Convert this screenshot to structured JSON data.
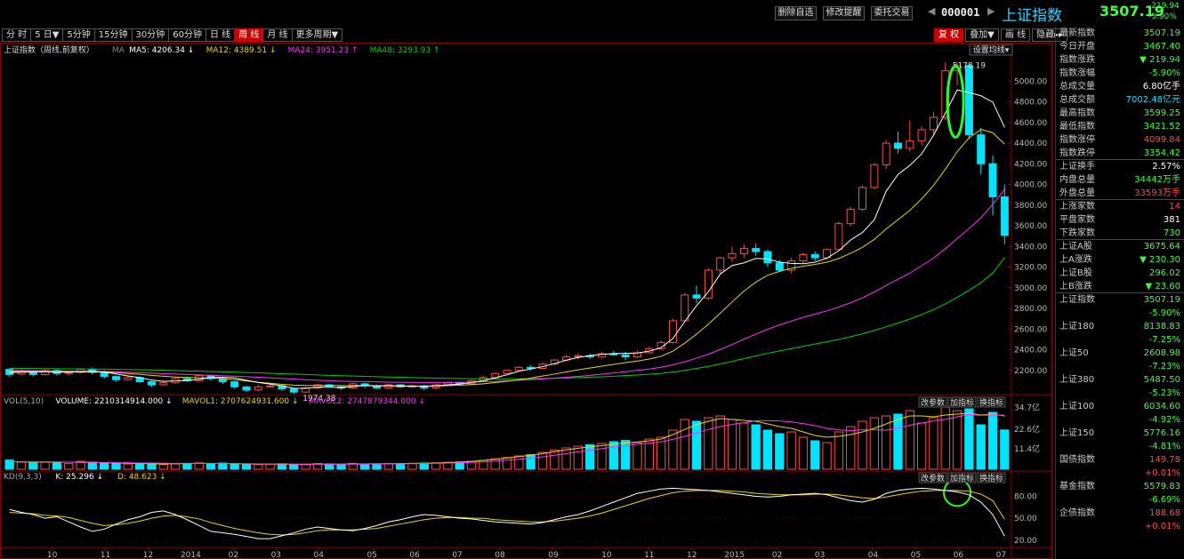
{
  "toolbar": {
    "delete_watch": "删除自选",
    "alert": "修改提醒",
    "trade": "委托交易"
  },
  "stock": {
    "code": "000001",
    "name": "上证指数",
    "price": "3507.19",
    "change": "-219.94",
    "pct": "-5.90%"
  },
  "periods": [
    "分 时",
    "5 日▼",
    "5分钟",
    "15分钟",
    "30分钟",
    "60分钟",
    "日 线",
    "周 线",
    "月 线",
    "更多周期▼"
  ],
  "active_period": "周 线",
  "right_tools": [
    "复 权",
    "叠加▼",
    "画 线",
    "隐藏▸▸"
  ],
  "ma_legend": {
    "title": "上证指数（周线,前复权）",
    "ma": "MA",
    "ma5": "MA5: 4206.34 ↓",
    "ma12": "MA12: 4389.51 ↓",
    "ma24": "MA24: 3951.23 ↑",
    "ma48": "MA48: 3293.93 ↑"
  },
  "set_ma": "设置均线▾",
  "peak_label": "5178.19",
  "low_label": "1974.38",
  "vol_legend": {
    "title": "VOL(5,10)",
    "volume": "VOLUME: 2210314914.000 ↓",
    "mavol1": "MAVOL1: 2707624931.600 ↓",
    "mavol2": "MAVOL2: 2747879344.000 ↓"
  },
  "kd_legend": {
    "title": "KD(9,3,3)",
    "k": "K: 25.296 ↓",
    "d": "D: 48.623 ↓"
  },
  "panel_btns": [
    "改参数",
    "加指标",
    "换指标"
  ],
  "price_axis": [
    "5000.00",
    "4800.00",
    "4600.00",
    "4400.00",
    "4200.00",
    "4000.00",
    "3800.00",
    "3600.00",
    "3400.00",
    "3200.00",
    "3000.00",
    "2800.00",
    "2600.00",
    "2400.00",
    "2200.00"
  ],
  "vol_axis": [
    "34.7亿",
    "22.6亿",
    "11.4亿"
  ],
  "kd_axis": [
    "80.00",
    "50.00",
    "20.00"
  ],
  "x_axis": [
    "10",
    "11",
    "12",
    "2014",
    "02",
    "03",
    "04",
    "05",
    "06",
    "07",
    "08",
    "09",
    "10",
    "11",
    "12",
    "2015",
    "02",
    "03",
    "04",
    "05",
    "06",
    "07"
  ],
  "colors": {
    "up": "#ff4a4a",
    "down": "#00e5ff",
    "ma5": "#ffffff",
    "ma12": "#e8d800",
    "ma24": "#ff30ff",
    "ma48": "#00d000",
    "highlight": "#22ff22"
  },
  "panel": [
    {
      "k": "最新指数",
      "v": "3507.19",
      "c": "#3fff3f"
    },
    {
      "k": "今日开盘",
      "v": "3467.40",
      "c": "#3fff3f"
    },
    {
      "k": "指数涨跌",
      "v": "▼ 219.94",
      "c": "#3fff3f"
    },
    {
      "k": "指数涨幅",
      "v": "-5.90%",
      "c": "#3fff3f"
    },
    {
      "k": "总成交量",
      "v": "6.80亿手",
      "c": "#ffffff"
    },
    {
      "k": "总成交额",
      "v": "7002.48亿元",
      "c": "#00e5ff"
    },
    {
      "k": "最高指数",
      "v": "3599.25",
      "c": "#3fff3f"
    },
    {
      "k": "最低指数",
      "v": "3421.52",
      "c": "#3fff3f"
    },
    {
      "k": "指数涨停",
      "v": "4099.84",
      "c": "#ff4a4a"
    },
    {
      "k": "指数跌停",
      "v": "3354.42",
      "c": "#3fff3f",
      "sep_after": true
    },
    {
      "k": "上证换手",
      "v": "2.57%",
      "c": "#ffffff"
    },
    {
      "k": "内盘总量",
      "v": "34442万手",
      "c": "#3fff3f"
    },
    {
      "k": "外盘总量",
      "v": "33593万手",
      "c": "#ff4a4a",
      "sep_after": true
    },
    {
      "k": "上涨家数",
      "v": "14",
      "c": "#ff4a4a"
    },
    {
      "k": "平盘家数",
      "v": "381",
      "c": "#ffffff"
    },
    {
      "k": "下跌家数",
      "v": "730",
      "c": "#3fff3f",
      "sep_after": true
    },
    {
      "k": "上证A股",
      "v": "3675.64",
      "c": "#3fff3f"
    },
    {
      "k": "上A涨跌",
      "v": "▼ 230.30",
      "c": "#3fff3f"
    },
    {
      "k": "上证B股",
      "v": "296.02",
      "c": "#3fff3f"
    },
    {
      "k": "上B涨跌",
      "v": "▼ 23.60",
      "c": "#3fff3f",
      "sep_after": true
    },
    {
      "k": "上证指数",
      "v": "3507.19",
      "c": "#3fff3f"
    },
    {
      "k": "",
      "v": "-5.90%",
      "c": "#3fff3f"
    },
    {
      "k": "上证180",
      "v": "8138.83",
      "c": "#3fff3f"
    },
    {
      "k": "",
      "v": "-7.25%",
      "c": "#3fff3f"
    },
    {
      "k": "上证50",
      "v": "2608.98",
      "c": "#3fff3f"
    },
    {
      "k": "",
      "v": "-7.23%",
      "c": "#3fff3f"
    },
    {
      "k": "上证380",
      "v": "5487.50",
      "c": "#3fff3f"
    },
    {
      "k": "",
      "v": "-5.23%",
      "c": "#3fff3f"
    },
    {
      "k": "上证100",
      "v": "6034.60",
      "c": "#3fff3f"
    },
    {
      "k": "",
      "v": "-4.92%",
      "c": "#3fff3f"
    },
    {
      "k": "上证150",
      "v": "5776.16",
      "c": "#3fff3f"
    },
    {
      "k": "",
      "v": "-4.81%",
      "c": "#3fff3f"
    },
    {
      "k": "国债指数",
      "v": "149.78",
      "c": "#ff4a4a"
    },
    {
      "k": "",
      "v": "+0.01%",
      "c": "#ff4a4a"
    },
    {
      "k": "基金指数",
      "v": "5579.83",
      "c": "#3fff3f"
    },
    {
      "k": "",
      "v": "-6.69%",
      "c": "#3fff3f"
    },
    {
      "k": "企债指数",
      "v": "188.68",
      "c": "#ff4a4a"
    },
    {
      "k": "",
      "v": "+0.01%",
      "c": "#ff4a4a"
    }
  ],
  "chart_data": {
    "type": "candlestick",
    "price_ylim": [
      2000,
      5200
    ],
    "candles": [
      [
        2210,
        2160,
        2220,
        2140
      ],
      [
        2165,
        2190,
        2210,
        2150
      ],
      [
        2190,
        2160,
        2200,
        2140
      ],
      [
        2160,
        2200,
        2210,
        2150
      ],
      [
        2200,
        2170,
        2210,
        2150
      ],
      [
        2170,
        2180,
        2200,
        2150
      ],
      [
        2180,
        2210,
        2220,
        2170
      ],
      [
        2210,
        2180,
        2230,
        2160
      ],
      [
        2180,
        2140,
        2200,
        2120
      ],
      [
        2140,
        2110,
        2150,
        2090
      ],
      [
        2110,
        2130,
        2140,
        2100
      ],
      [
        2130,
        2090,
        2140,
        2080
      ],
      [
        2090,
        2060,
        2100,
        2040
      ],
      [
        2060,
        2080,
        2100,
        2050
      ],
      [
        2080,
        2120,
        2130,
        2070
      ],
      [
        2120,
        2100,
        2140,
        2090
      ],
      [
        2100,
        2150,
        2160,
        2090
      ],
      [
        2150,
        2120,
        2160,
        2100
      ],
      [
        2120,
        2090,
        2130,
        2070
      ],
      [
        2090,
        2040,
        2100,
        2020
      ],
      [
        2040,
        2010,
        2050,
        1990
      ],
      [
        2010,
        2040,
        2060,
        2000
      ],
      [
        2040,
        2050,
        2070,
        2030
      ],
      [
        2050,
        2020,
        2060,
        2000
      ],
      [
        2020,
        1990,
        2030,
        1974
      ],
      [
        1990,
        2030,
        2040,
        1980
      ],
      [
        2030,
        2060,
        2070,
        2020
      ],
      [
        2060,
        2040,
        2070,
        2030
      ],
      [
        2040,
        2030,
        2050,
        2010
      ],
      [
        2030,
        2070,
        2080,
        2020
      ],
      [
        2070,
        2050,
        2080,
        2030
      ],
      [
        2050,
        2030,
        2060,
        2020
      ],
      [
        2030,
        2060,
        2070,
        2020
      ],
      [
        2060,
        2040,
        2070,
        2030
      ],
      [
        2040,
        2050,
        2060,
        2030
      ],
      [
        2050,
        2030,
        2060,
        2010
      ],
      [
        2030,
        2060,
        2070,
        2020
      ],
      [
        2060,
        2080,
        2090,
        2050
      ],
      [
        2080,
        2070,
        2090,
        2060
      ],
      [
        2070,
        2100,
        2110,
        2060
      ],
      [
        2100,
        2130,
        2150,
        2090
      ],
      [
        2130,
        2170,
        2180,
        2120
      ],
      [
        2170,
        2200,
        2210,
        2160
      ],
      [
        2200,
        2230,
        2240,
        2190
      ],
      [
        2230,
        2220,
        2250,
        2200
      ],
      [
        2220,
        2260,
        2280,
        2210
      ],
      [
        2260,
        2300,
        2310,
        2250
      ],
      [
        2300,
        2330,
        2350,
        2290
      ],
      [
        2330,
        2340,
        2370,
        2310
      ],
      [
        2340,
        2330,
        2360,
        2310
      ],
      [
        2330,
        2360,
        2380,
        2320
      ],
      [
        2360,
        2350,
        2390,
        2340
      ],
      [
        2350,
        2330,
        2380,
        2300
      ],
      [
        2330,
        2370,
        2390,
        2320
      ],
      [
        2370,
        2410,
        2430,
        2360
      ],
      [
        2410,
        2470,
        2490,
        2400
      ],
      [
        2470,
        2680,
        2700,
        2460
      ],
      [
        2680,
        2930,
        2950,
        2670
      ],
      [
        2930,
        2900,
        3020,
        2850
      ],
      [
        2900,
        3170,
        3190,
        2880
      ],
      [
        3170,
        3290,
        3300,
        3140
      ],
      [
        3290,
        3330,
        3400,
        3250
      ],
      [
        3330,
        3380,
        3420,
        3290
      ],
      [
        3380,
        3350,
        3430,
        3310
      ],
      [
        3350,
        3240,
        3370,
        3200
      ],
      [
        3240,
        3170,
        3270,
        3150
      ],
      [
        3170,
        3260,
        3290,
        3140
      ],
      [
        3260,
        3320,
        3340,
        3230
      ],
      [
        3320,
        3290,
        3350,
        3260
      ],
      [
        3290,
        3370,
        3380,
        3270
      ],
      [
        3370,
        3620,
        3640,
        3360
      ],
      [
        3620,
        3760,
        3780,
        3600
      ],
      [
        3760,
        3970,
        3990,
        3740
      ],
      [
        3970,
        4190,
        4210,
        3950
      ],
      [
        4190,
        4400,
        4430,
        4150
      ],
      [
        4400,
        4350,
        4510,
        4300
      ],
      [
        4350,
        4420,
        4620,
        4320
      ],
      [
        4420,
        4530,
        4560,
        4380
      ],
      [
        4530,
        4650,
        4700,
        4480
      ],
      [
        4650,
        5100,
        5180,
        4620
      ],
      [
        5100,
        5150,
        5178,
        4960
      ],
      [
        5150,
        4480,
        5170,
        4440
      ],
      [
        4480,
        4200,
        4550,
        4100
      ],
      [
        4200,
        3880,
        4280,
        3700
      ],
      [
        3880,
        3507,
        4000,
        3421
      ]
    ],
    "ma5": [
      2180,
      2183,
      2185,
      2186,
      2184,
      2183,
      2186,
      2188,
      2184,
      2166,
      2146,
      2130,
      2106,
      2094,
      2098,
      2101,
      2114,
      2129,
      2133,
      2128,
      2104,
      2083,
      2068,
      2049,
      2027,
      2026,
      2038,
      2039,
      2033,
      2044,
      2054,
      2052,
      2052,
      2050,
      2048,
      2046,
      2049,
      2060,
      2067,
      2082,
      2100,
      2128,
      2158,
      2191,
      2214,
      2236,
      2266,
      2298,
      2325,
      2344,
      2355,
      2362,
      2365,
      2368,
      2386,
      2420,
      2508,
      2672,
      2826,
      2962,
      3133,
      3215,
      3241,
      3284,
      3278,
      3247,
      3235,
      3232,
      3247,
      3287,
      3358,
      3462,
      3535,
      3657,
      3934,
      4096,
      4184,
      4296,
      4476,
      4690,
      4914,
      4889,
      4858,
      4796,
      4551
    ],
    "ma12": [
      2190,
      2189,
      2188,
      2187,
      2186,
      2185,
      2185,
      2186,
      2185,
      2179,
      2170,
      2162,
      2152,
      2143,
      2136,
      2131,
      2128,
      2126,
      2120,
      2111,
      2098,
      2085,
      2075,
      2065,
      2057,
      2054,
      2054,
      2055,
      2053,
      2053,
      2053,
      2049,
      2049,
      2047,
      2046,
      2046,
      2048,
      2053,
      2056,
      2062,
      2070,
      2082,
      2095,
      2110,
      2126,
      2145,
      2164,
      2185,
      2205,
      2223,
      2241,
      2258,
      2275,
      2290,
      2310,
      2336,
      2387,
      2464,
      2551,
      2648,
      2754,
      2863,
      2968,
      3054,
      3121,
      3158,
      3187,
      3209,
      3226,
      3247,
      3283,
      3334,
      3391,
      3468,
      3569,
      3659,
      3749,
      3860,
      3990,
      4148,
      4317,
      4451,
      4532,
      4500,
      4390
    ],
    "ma24": [
      2200,
      2199,
      2198,
      2197,
      2195,
      2193,
      2192,
      2191,
      2189,
      2186,
      2182,
      2178,
      2173,
      2168,
      2164,
      2160,
      2156,
      2152,
      2148,
      2144,
      2139,
      2133,
      2128,
      2122,
      2116,
      2110,
      2104,
      2099,
      2095,
      2093,
      2091,
      2088,
      2086,
      2085,
      2084,
      2083,
      2083,
      2084,
      2085,
      2087,
      2089,
      2093,
      2098,
      2104,
      2110,
      2117,
      2125,
      2133,
      2142,
      2152,
      2163,
      2175,
      2187,
      2200,
      2213,
      2230,
      2253,
      2283,
      2319,
      2357,
      2402,
      2451,
      2502,
      2551,
      2598,
      2640,
      2678,
      2713,
      2745,
      2776,
      2813,
      2855,
      2903,
      2958,
      3022,
      3082,
      3142,
      3213,
      3287,
      3378,
      3476,
      3574,
      3676,
      3808,
      3951
    ],
    "ma48": [
      2220,
      2219,
      2218,
      2217,
      2216,
      2215,
      2214,
      2213,
      2212,
      2210,
      2208,
      2206,
      2204,
      2201,
      2198,
      2195,
      2192,
      2189,
      2186,
      2183,
      2180,
      2176,
      2172,
      2168,
      2164,
      2160,
      2156,
      2152,
      2148,
      2145,
      2142,
      2139,
      2136,
      2133,
      2130,
      2127,
      2125,
      2123,
      2121,
      2119,
      2118,
      2117,
      2117,
      2118,
      2119,
      2121,
      2123,
      2126,
      2130,
      2134,
      2138,
      2143,
      2149,
      2155,
      2162,
      2171,
      2184,
      2200,
      2219,
      2239,
      2262,
      2287,
      2314,
      2340,
      2365,
      2388,
      2411,
      2433,
      2455,
      2476,
      2500,
      2526,
      2554,
      2586,
      2622,
      2658,
      2697,
      2740,
      2788,
      2845,
      2908,
      2976,
      3048,
      3142,
      3294
    ],
    "volume": [
      5.2,
      4.0,
      3.5,
      4.2,
      3.8,
      3.2,
      4.5,
      4.0,
      3.6,
      3.4,
      3.0,
      3.2,
      3.4,
      2.6,
      3.0,
      3.3,
      3.6,
      3.1,
      3.5,
      3.2,
      2.8,
      2.6,
      2.9,
      3.1,
      2.7,
      2.5,
      3.2,
      3.0,
      2.6,
      3.3,
      3.0,
      3.0,
      3.2,
      3.1,
      3.3,
      3.5,
      3.6,
      3.9,
      4.1,
      4.5,
      5.0,
      5.8,
      6.6,
      7.5,
      8.2,
      9.5,
      10.8,
      12.0,
      13.0,
      13.8,
      14.5,
      15.5,
      16.2,
      15.0,
      17.0,
      18.0,
      22.0,
      28.0,
      27.0,
      29.0,
      30.0,
      28.0,
      26.0,
      25.0,
      22.0,
      20.0,
      21.0,
      18.0,
      16.0,
      15.0,
      21.0,
      24.0,
      27.0,
      29.0,
      30.0,
      31.0,
      33.0,
      26.0,
      29.0,
      35.0,
      33.0,
      34.0,
      25.0,
      32.0,
      22.1
    ],
    "mavol1": [
      4.2,
      4.1,
      4.0,
      4.0,
      4.0,
      4.0,
      3.9,
      3.8,
      3.7,
      3.5,
      3.4,
      3.2,
      3.1,
      3.0,
      3.1,
      3.2,
      3.3,
      3.3,
      3.2,
      3.1,
      3.0,
      2.9,
      2.9,
      2.8,
      2.8,
      2.8,
      2.9,
      2.9,
      2.9,
      3.0,
      3.0,
      3.1,
      3.1,
      3.2,
      3.3,
      3.4,
      3.5,
      3.8,
      4.0,
      4.4,
      5.0,
      5.6,
      6.3,
      7.1,
      7.9,
      8.8,
      9.8,
      10.9,
      11.8,
      12.6,
      13.3,
      14.0,
      14.8,
      15.3,
      16.0,
      17.0,
      19.5,
      22.4,
      25.0,
      27.0,
      28.5,
      28.0,
      27.5,
      27.0,
      25.5,
      24.0,
      23.0,
      21.0,
      19.0,
      18.0,
      18.5,
      19.5,
      21.0,
      23.0,
      25.5,
      28.0,
      30.0,
      30.0,
      29.5,
      30.5,
      31.0,
      31.5,
      30.5,
      31.0,
      30.0
    ],
    "mavol2": [
      4.3,
      4.2,
      4.2,
      4.1,
      4.1,
      4.0,
      4.0,
      3.9,
      3.8,
      3.7,
      3.6,
      3.5,
      3.5,
      3.4,
      3.3,
      3.3,
      3.3,
      3.2,
      3.2,
      3.2,
      3.1,
      3.0,
      3.0,
      3.0,
      2.9,
      2.9,
      2.9,
      2.9,
      2.9,
      2.9,
      2.9,
      3.0,
      3.0,
      3.1,
      3.1,
      3.2,
      3.3,
      3.5,
      3.6,
      3.9,
      4.2,
      4.6,
      5.1,
      5.6,
      6.3,
      7.0,
      7.9,
      8.8,
      9.8,
      10.7,
      11.6,
      12.5,
      13.3,
      14.1,
      14.7,
      15.4,
      16.8,
      18.5,
      20.5,
      22.4,
      24.0,
      25.2,
      26.2,
      27.3,
      27.3,
      27.2,
      26.6,
      25.7,
      24.5,
      23.0,
      22.2,
      21.7,
      22.2,
      22.2,
      22.0,
      23.0,
      24.8,
      26.0,
      27.2,
      28.0,
      29.5,
      30.8,
      30.3,
      30.6,
      30.4
    ],
    "vol_ylim": [
      0,
      38
    ],
    "k": [
      62,
      58,
      55,
      50,
      52,
      45,
      38,
      32,
      35,
      42,
      48,
      52,
      58,
      60,
      55,
      48,
      40,
      32,
      30,
      28,
      25,
      22,
      22,
      26,
      30,
      35,
      38,
      36,
      34,
      33,
      36,
      40,
      45,
      48,
      52,
      55,
      54,
      52,
      50,
      49,
      47,
      45,
      44,
      43,
      42,
      44,
      48,
      52,
      55,
      60,
      66,
      72,
      78,
      84,
      87,
      90,
      91,
      90,
      89,
      88,
      86,
      84,
      82,
      80,
      79,
      80,
      82,
      83,
      84,
      82,
      78,
      74,
      72,
      76,
      84,
      88,
      90,
      91,
      90,
      88,
      86,
      82,
      72,
      55,
      25.3
    ],
    "d": [
      58,
      57,
      56,
      54,
      53,
      51,
      47,
      43,
      40,
      41,
      43,
      46,
      50,
      53,
      54,
      52,
      49,
      44,
      40,
      36,
      33,
      30,
      28,
      27,
      28,
      30,
      33,
      34,
      34,
      34,
      35,
      36,
      39,
      42,
      45,
      48,
      50,
      51,
      51,
      50,
      50,
      48,
      47,
      46,
      45,
      45,
      46,
      48,
      50,
      53,
      57,
      62,
      67,
      72,
      77,
      81,
      85,
      87,
      88,
      88,
      88,
      87,
      86,
      84,
      83,
      82,
      82,
      82,
      83,
      83,
      82,
      80,
      78,
      77,
      79,
      82,
      85,
      87,
      88,
      88,
      88,
      87,
      83,
      74,
      48.6
    ],
    "kd_ylim": [
      10,
      100
    ]
  }
}
